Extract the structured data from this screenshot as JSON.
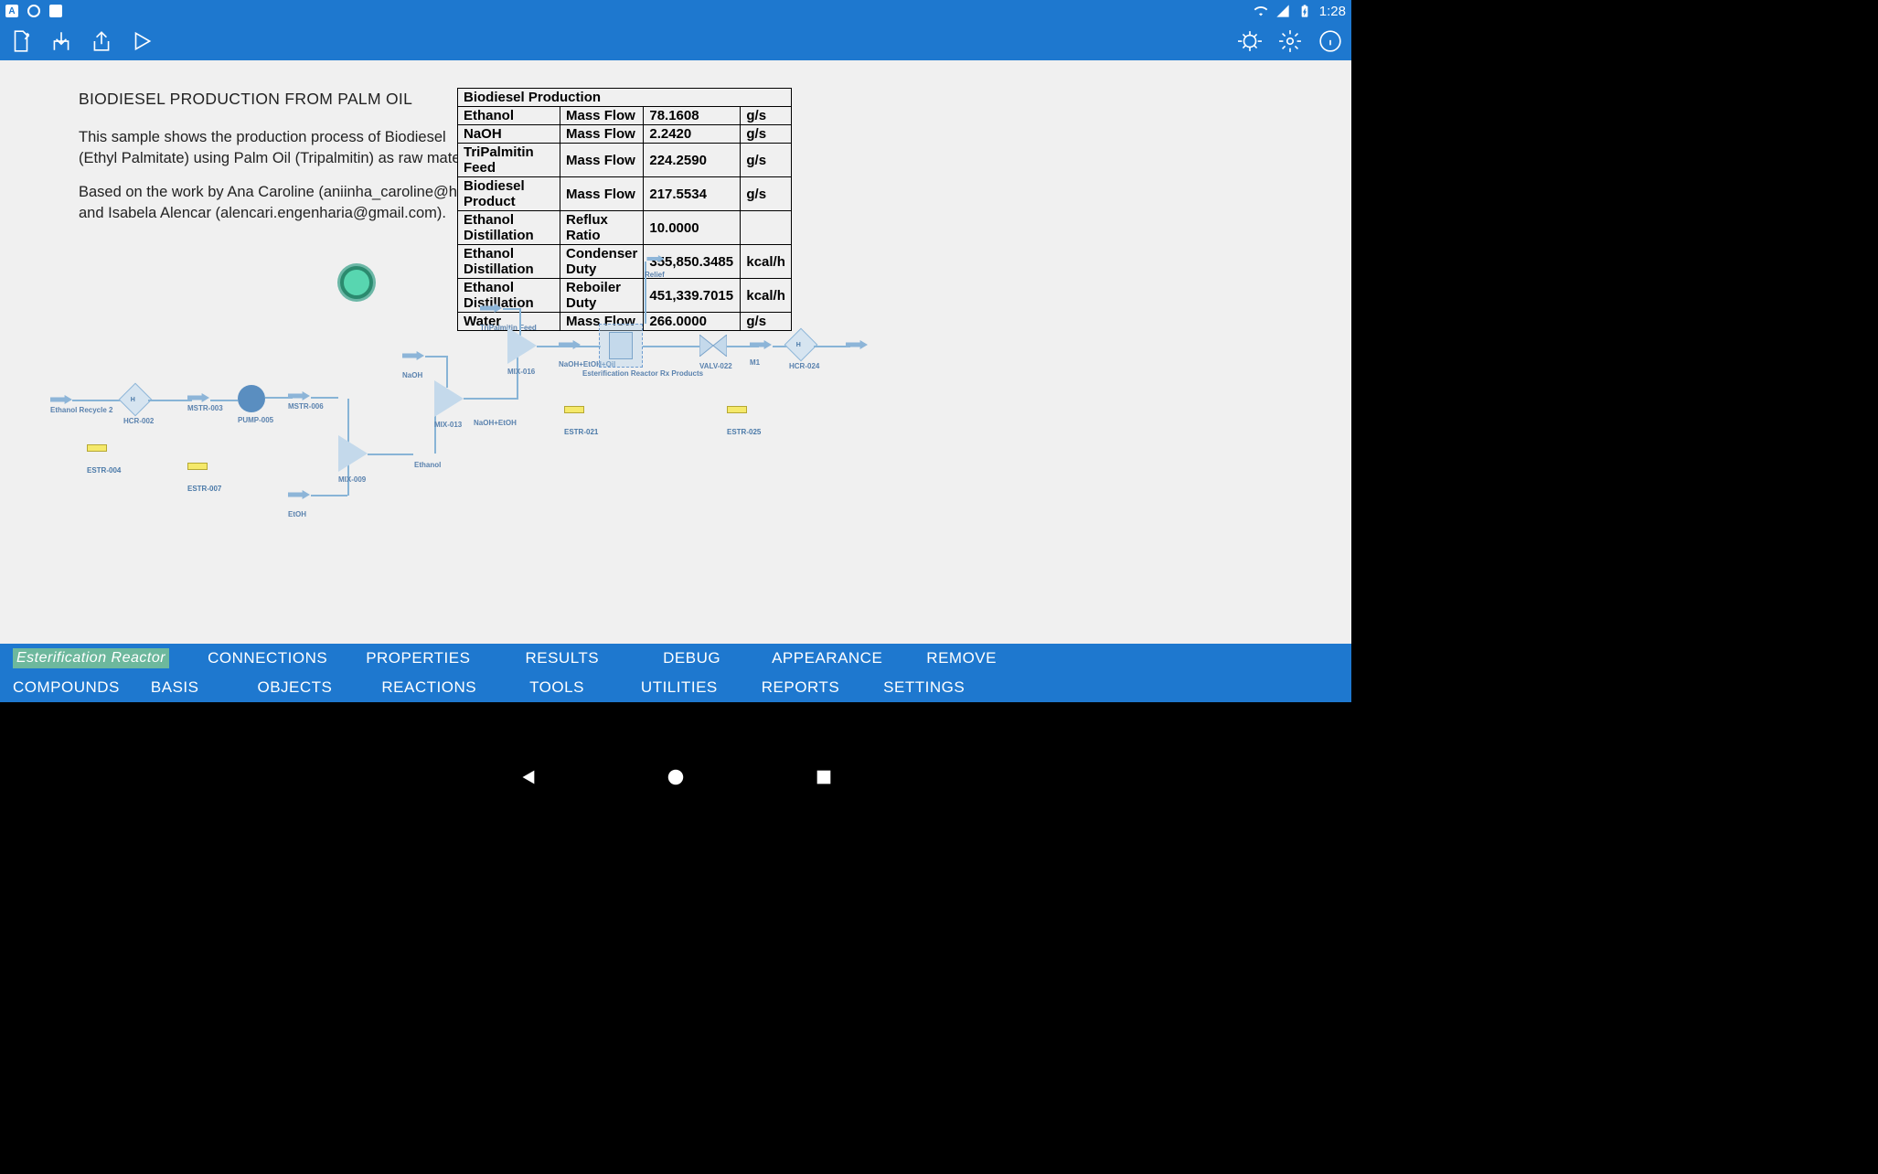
{
  "status": {
    "time": "1:28"
  },
  "doc": {
    "title": "BIODIESEL PRODUCTION FROM PALM OIL",
    "line1": "This sample shows the production process of Biodiesel",
    "line2": "(Ethyl Palmitate) using Palm Oil (Tripalmitin) as raw material.",
    "line3": "Based on the work by Ana Caroline (aniinha_caroline@hotmail.com)",
    "line4": " and Isabela Alencar (alencari.engenharia@gmail.com)."
  },
  "table": {
    "header": "Biodiesel Production",
    "rows": [
      {
        "p": "Ethanol",
        "n": "Mass Flow",
        "v": "78.1608",
        "u": "g/s"
      },
      {
        "p": "NaOH",
        "n": "Mass Flow",
        "v": "2.2420",
        "u": "g/s"
      },
      {
        "p": "TriPalmitin Feed",
        "n": "Mass Flow",
        "v": "224.2590",
        "u": "g/s"
      },
      {
        "p": "Biodiesel Product",
        "n": "Mass Flow",
        "v": "217.5534",
        "u": "g/s"
      },
      {
        "p": "Ethanol Distillation",
        "n": "Reflux Ratio",
        "v": "10.0000",
        "u": ""
      },
      {
        "p": "Ethanol Distillation",
        "n": "Condenser Duty",
        "v": "355,850.3485",
        "u": "kcal/h"
      },
      {
        "p": "Ethanol Distillation",
        "n": "Reboiler Duty",
        "v": "451,339.7015",
        "u": "kcal/h"
      },
      {
        "p": "Water",
        "n": "Mass Flow",
        "v": "266.0000",
        "u": "g/s"
      }
    ]
  },
  "flow": {
    "ethanol_recycle": "Ethanol Recycle 2",
    "mstr003": "MSTR-003",
    "hcr002": "HCR-002",
    "pump005": "PUMP-005",
    "mstr006": "MSTR-006",
    "mix009": "MIX-009",
    "ethanol": "Ethanol",
    "etoh": "EtOH",
    "naoh": "NaOH",
    "mix013": "MIX-013",
    "naoh_etoh": "NaOH+EtOH",
    "tripalmitin": "TriPalmitin Feed",
    "mix016": "MIX-016",
    "naoh_etoh_oil": "NaOH+EtOH+Oil",
    "esterification": "Esterification Reactor",
    "rx_products": "Rx Products",
    "relief": "Relief",
    "valv022": "VALV-022",
    "m1": "M1",
    "hcr024": "HCR-024",
    "estr004": "ESTR-004",
    "estr007": "ESTR-007",
    "estr021": "ESTR-021",
    "estr025": "ESTR-025"
  },
  "tabs": {
    "selected": "Esterification Reactor",
    "row1": [
      "CONNECTIONS",
      "PROPERTIES",
      "RESULTS",
      "DEBUG",
      "APPEARANCE",
      "REMOVE"
    ],
    "row2": [
      "COMPOUNDS",
      "BASIS",
      "OBJECTS",
      "REACTIONS",
      "TOOLS",
      "UTILITIES",
      "REPORTS",
      "SETTINGS"
    ]
  }
}
